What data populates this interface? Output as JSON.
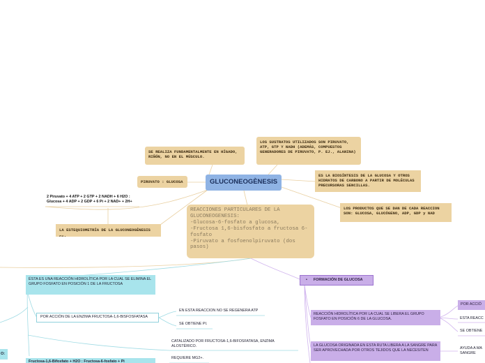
{
  "central": {
    "title": "GLUCONEOGÈNESIS"
  },
  "nodes": {
    "hepatic": "SE REALIZA FUNDAMENTALMENTE EN HÍGADO, RIÑÓN, NO EN EL MÚSCULO.",
    "substrates": "LOS SUSTRATOS UTILIZADOS SON PIRUVATO, ATP, GTP Y NADH (ADEMÁS, COMPUESTOS GENERADORES DE PIRUVATO, P. EJ., ALANINA)",
    "pyruvate": "PIRUVATO :  GLUCOSA",
    "definition": "ES LA BIOSÍNTESIS DE LA GLUCOSA Y OTROS HIDRATOS DE CARBONO A PARTIR DE MOLÉCULAS PRECURSORAS SENCILLAS.",
    "products": "LOS PRODUCTOS QUE SE DAN DE CADA REACCION SON: GLUCOSA, GLUCÓGENO, ADP, GDP y NAD",
    "equation": "2 Piruvato + 4 ATP + 2 GTP + 2 NADH + 6 H2O :\nGlucosa + 4 ADP + 2 GDP + 6 Pi + 2 NAD+ + 2H+",
    "stoichiometry": "LA ESTEQUIOMETRÍA DE LA GLUCONEOGÉNESIS ES:",
    "reactions": "REACCIONES PARTICULARES DE LA GLUCONEOGENESIS:\n-Glucosa-6-fosfato a glucosa,\n-Fructosa 1,6-bisfosfato a fructosa 6-fosfato\n-Piruvato a fosfoenolpiruvato (dos pasos)"
  },
  "left_branch": {
    "hydrolytic": "ÉSTA ES UNA REACCIÓN HIDROLÍTICA POR LA CUAL SE ELIMINA EL GRUPO FOSFATO EN POSICIÓN 1 DE LA FRUCTOSA",
    "enzyme_action": "POR ACCIÓN DE LA ENZIMA FRUCTOSA-1,6-BISFOSFATASA",
    "no_atp": "EN ESTA REACCIÓN NO SE REGENERA ATP",
    "pi": "SE OBTIENE PI.",
    "catalyzed": "CATALIZADO POR FRUCTOSA-1,6-BIFOSFATASA, ENZIMA ALOSTÉRICO.",
    "mg": "REQUIERE MG2+.",
    "cut_left": "O:",
    "cut_bottom": "Fructosa-1,6-Bifosfato + H2O : Fructosa-6-fosfato + Pi"
  },
  "right_branch": {
    "formation": "FORMACIÓN DE GLUCOSA",
    "hydrolytic": "REACCIÓN HIDROLÍTICA POR LA CUAL SE LIBERA EL GRUPO FOSFATO EN POSICIÓN 6 DE LA GLUCOSA.",
    "released": "LA GLUCOSA ORIGINADA EN ESTA RUTA LIBERA A LA SANGRE PARA SER APROVECHADA POR OTROS TEJIDOS QUE LA NECESITEN",
    "cut_1": "POR ACCIÓ",
    "cut_2": "ESTA REACC",
    "cut_3": "SE OBTIENE",
    "cut_4": "AYUDA A MA\nSANGRE"
  }
}
